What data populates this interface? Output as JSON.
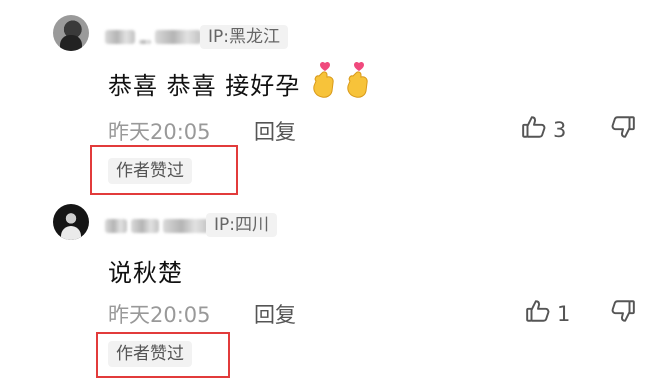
{
  "comments": [
    {
      "ip": "IP:黑龙江",
      "text": "恭喜 恭喜 接好孕",
      "emoji": [
        "crossed-fingers-heart-icon",
        "crossed-fingers-heart-icon"
      ],
      "time": "昨天20:05",
      "reply_label": "回复",
      "like_count": "3",
      "author_tag": "作者赞过"
    },
    {
      "ip": "IP:四川",
      "text": "说秋楚",
      "time": "昨天20:05",
      "reply_label": "回复",
      "like_count": "1",
      "author_tag": "作者赞过"
    }
  ],
  "colors": {
    "highlight_box": "#e23b3b",
    "muted_text": "#999999",
    "tag_bg": "#f2f2f2"
  }
}
